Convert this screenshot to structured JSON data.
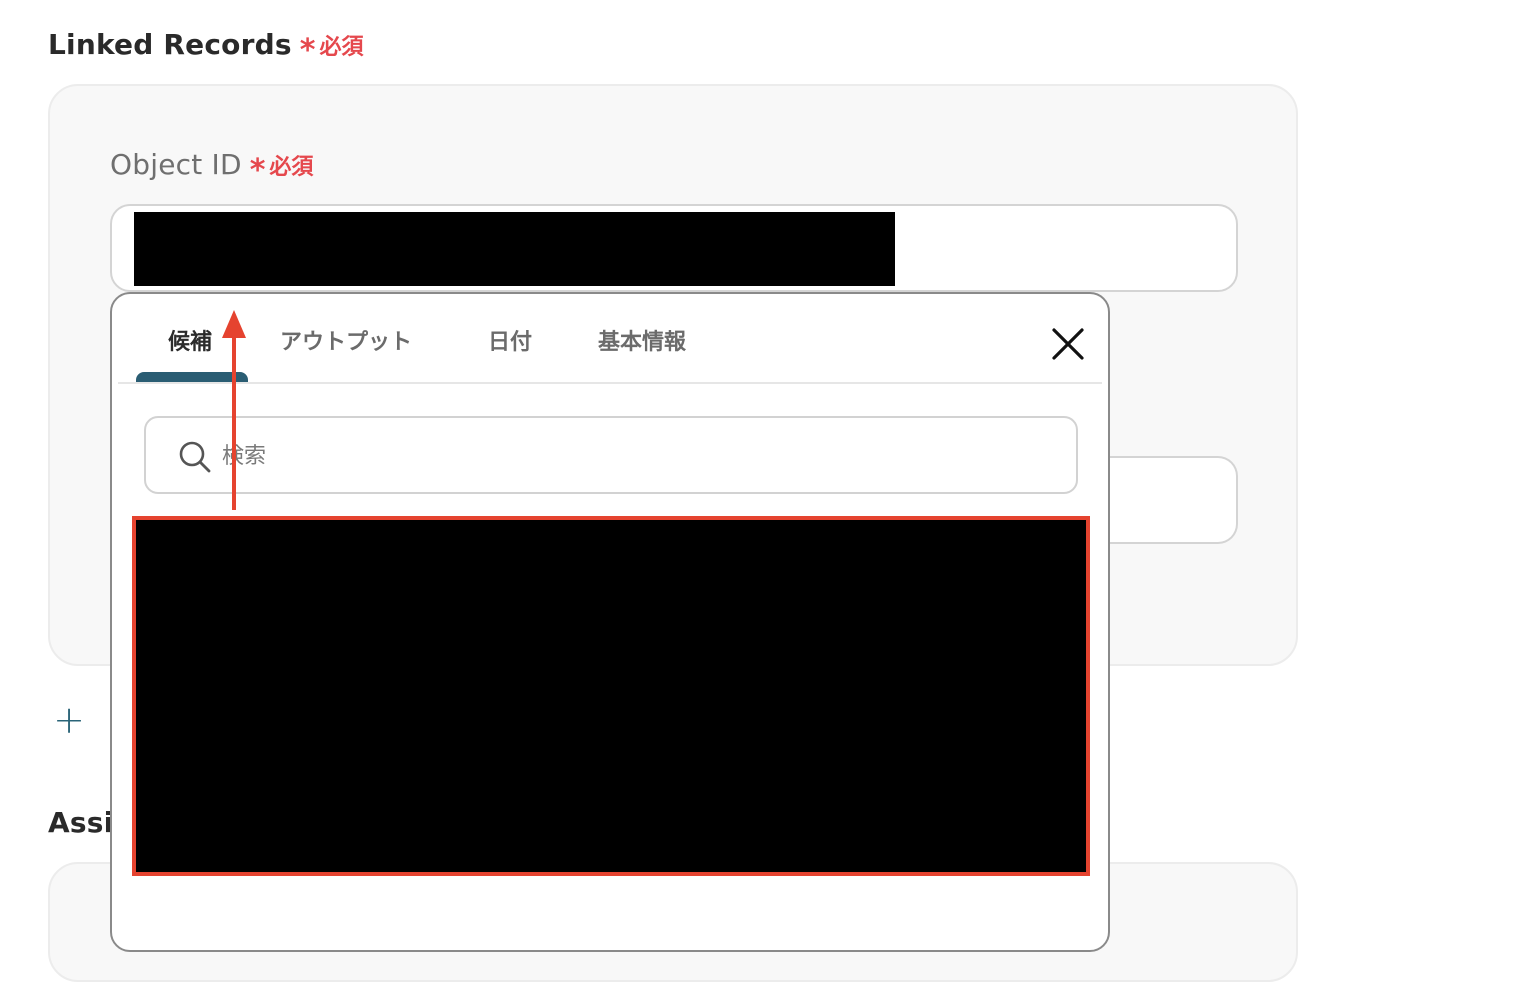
{
  "linked_records": {
    "label": "Linked Records",
    "required_label": "必須"
  },
  "object_id": {
    "label": "Object ID",
    "required_label": "必須",
    "value": "(redacted)"
  },
  "popup": {
    "tabs": [
      {
        "label": "候補",
        "active": true
      },
      {
        "label": "アウトプット",
        "active": false
      },
      {
        "label": "日付",
        "active": false
      },
      {
        "label": "基本情報",
        "active": false
      }
    ],
    "close_icon": "close-icon",
    "search": {
      "placeholder": "検索",
      "icon": "search-icon"
    }
  },
  "add_button": {
    "icon": "plus-icon"
  },
  "next_section": {
    "label": "Assi"
  },
  "colors": {
    "required": "#e5484d",
    "accent": "#2a5d73",
    "highlight": "#e5432f",
    "redaction": "#000000"
  }
}
